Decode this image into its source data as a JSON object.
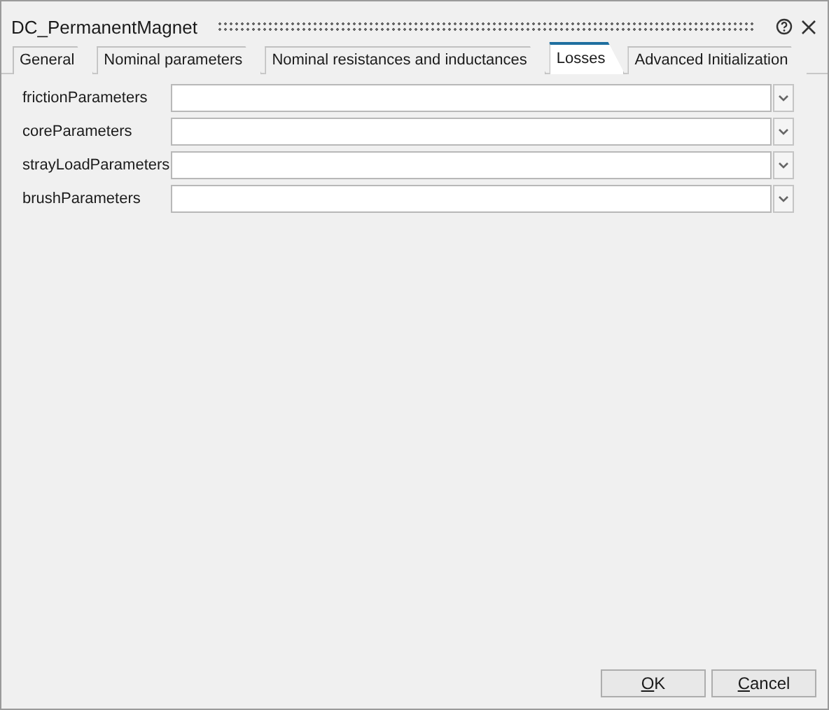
{
  "window": {
    "title": "DC_PermanentMagnet"
  },
  "tabs": [
    {
      "label": "General",
      "selected": false
    },
    {
      "label": "Nominal parameters",
      "selected": false
    },
    {
      "label": "Nominal resistances and inductances",
      "selected": false
    },
    {
      "label": "Losses",
      "selected": true
    },
    {
      "label": "Advanced Initialization",
      "selected": false
    }
  ],
  "parameters": [
    {
      "label": "frictionParameters"
    },
    {
      "label": "coreParameters"
    },
    {
      "label": "strayLoadParameters"
    },
    {
      "label": "brushParameters"
    }
  ],
  "buttons": [
    {
      "access_key": "O",
      "rest": "K"
    },
    {
      "access_key": "C",
      "rest": "ancel"
    }
  ]
}
